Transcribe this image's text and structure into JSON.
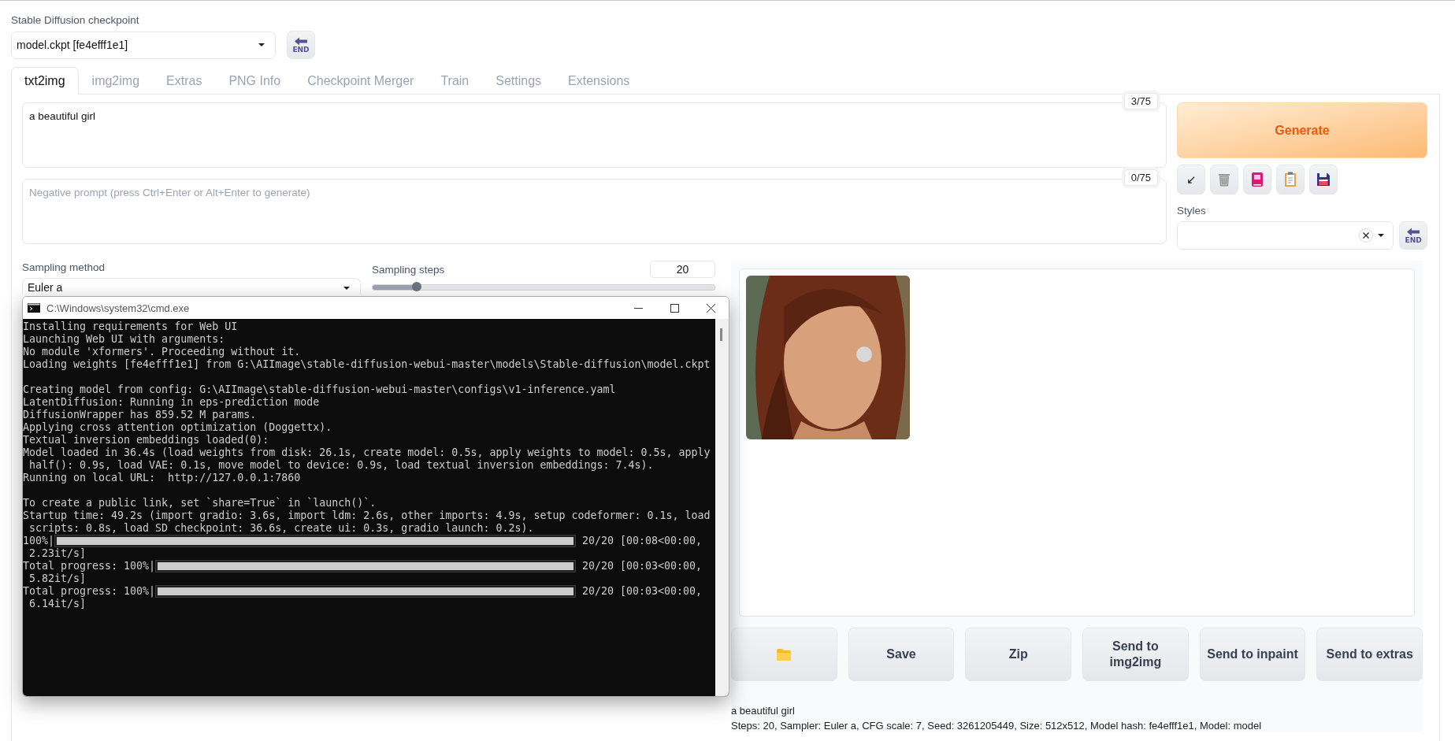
{
  "checkpoint": {
    "label": "Stable Diffusion checkpoint",
    "value": "model.ckpt [fe4efff1e1]",
    "refresh_label": "END"
  },
  "tabs": [
    {
      "label": "txt2img",
      "selected": true
    },
    {
      "label": "img2img",
      "selected": false
    },
    {
      "label": "Extras",
      "selected": false
    },
    {
      "label": "PNG Info",
      "selected": false
    },
    {
      "label": "Checkpoint Merger",
      "selected": false
    },
    {
      "label": "Train",
      "selected": false
    },
    {
      "label": "Settings",
      "selected": false
    },
    {
      "label": "Extensions",
      "selected": false
    }
  ],
  "prompt": {
    "value": "a beautiful girl",
    "counter": "3/75"
  },
  "negative_prompt": {
    "placeholder": "Negative prompt (press Ctrl+Enter or Alt+Enter to generate)",
    "counter": "0/75"
  },
  "generate_button": "Generate",
  "tool_buttons": [
    {
      "kind": "arrow",
      "glyph": "↙"
    },
    {
      "kind": "trash"
    },
    {
      "kind": "book"
    },
    {
      "kind": "clipboard"
    },
    {
      "kind": "floppy"
    }
  ],
  "styles": {
    "label": "Styles",
    "apply_label": "END"
  },
  "sampling_method": {
    "label": "Sampling method",
    "value": "Euler a"
  },
  "sampling_steps": {
    "label": "Sampling steps",
    "value": "20",
    "level": 0.13
  },
  "cmd_window": {
    "title": "C:\\Windows\\system32\\cmd.exe",
    "lines": [
      {
        "kind": "text",
        "text": "Installing requirements for Web UI"
      },
      {
        "kind": "text",
        "text": "Launching Web UI with arguments:"
      },
      {
        "kind": "text",
        "text": "No module 'xformers'. Proceeding without it."
      },
      {
        "kind": "text",
        "text": "Loading weights [fe4efff1e1] from G:\\AIImage\\stable-diffusion-webui-master\\models\\Stable-diffusion\\model.ckpt"
      },
      {
        "kind": "gap"
      },
      {
        "kind": "text",
        "text": "Creating model from config: G:\\AIImage\\stable-diffusion-webui-master\\configs\\v1-inference.yaml"
      },
      {
        "kind": "text",
        "text": "LatentDiffusion: Running in eps-prediction mode"
      },
      {
        "kind": "text",
        "text": "DiffusionWrapper has 859.52 M params."
      },
      {
        "kind": "text",
        "text": "Applying cross attention optimization (Doggettx)."
      },
      {
        "kind": "text",
        "text": "Textual inversion embeddings loaded(0):"
      },
      {
        "kind": "text",
        "text": "Model loaded in 36.4s (load weights from disk: 26.1s, create model: 0.5s, apply weights to model: 0.5s, apply"
      },
      {
        "kind": "text",
        "text": " half(): 0.9s, load VAE: 0.1s, move model to device: 0.9s, load textual inversion embeddings: 7.4s)."
      },
      {
        "kind": "text",
        "text": "Running on local URL:  http://127.0.0.1:7860"
      },
      {
        "kind": "gap"
      },
      {
        "kind": "text",
        "text": "To create a public link, set `share=True` in `launch()`."
      },
      {
        "kind": "text",
        "text": "Startup time: 49.2s (import gradio: 3.6s, import ldm: 2.6s, other imports: 4.9s, setup codeformer: 0.1s, load"
      },
      {
        "kind": "text",
        "text": " scripts: 0.8s, load SD checkpoint: 36.6s, create ui: 0.3s, gradio launch: 0.2s)."
      },
      {
        "kind": "progress",
        "label": "100%|",
        "level": 1,
        "reading": "20/20 [00:08<00:00,"
      },
      {
        "kind": "text",
        "text": " 2.23it/s]"
      },
      {
        "kind": "progress",
        "label": "Total progress: 100%|",
        "level": 1,
        "reading": "20/20 [00:03<00:00,"
      },
      {
        "kind": "text",
        "text": " 5.82it/s]"
      },
      {
        "kind": "progress",
        "label": "Total progress: 100%|",
        "level": 1,
        "reading": "20/20 [00:03<00:00,"
      },
      {
        "kind": "text",
        "text": " 6.14it/s]"
      }
    ]
  },
  "gallery": {
    "buttons": [
      {
        "kind": "folder"
      },
      {
        "kind": "text",
        "label": "Save"
      },
      {
        "kind": "text",
        "label": "Zip"
      },
      {
        "kind": "text",
        "label": "Send to img2img"
      },
      {
        "kind": "text",
        "label": "Send to inpaint"
      },
      {
        "kind": "text",
        "label": "Send to extras"
      }
    ],
    "info": [
      "a beautiful girl",
      "Steps: 20, Sampler: Euler a, CFG scale: 7, Seed: 3261205449, Size: 512x512, Model hash: fe4efff1e1, Model: model"
    ]
  }
}
